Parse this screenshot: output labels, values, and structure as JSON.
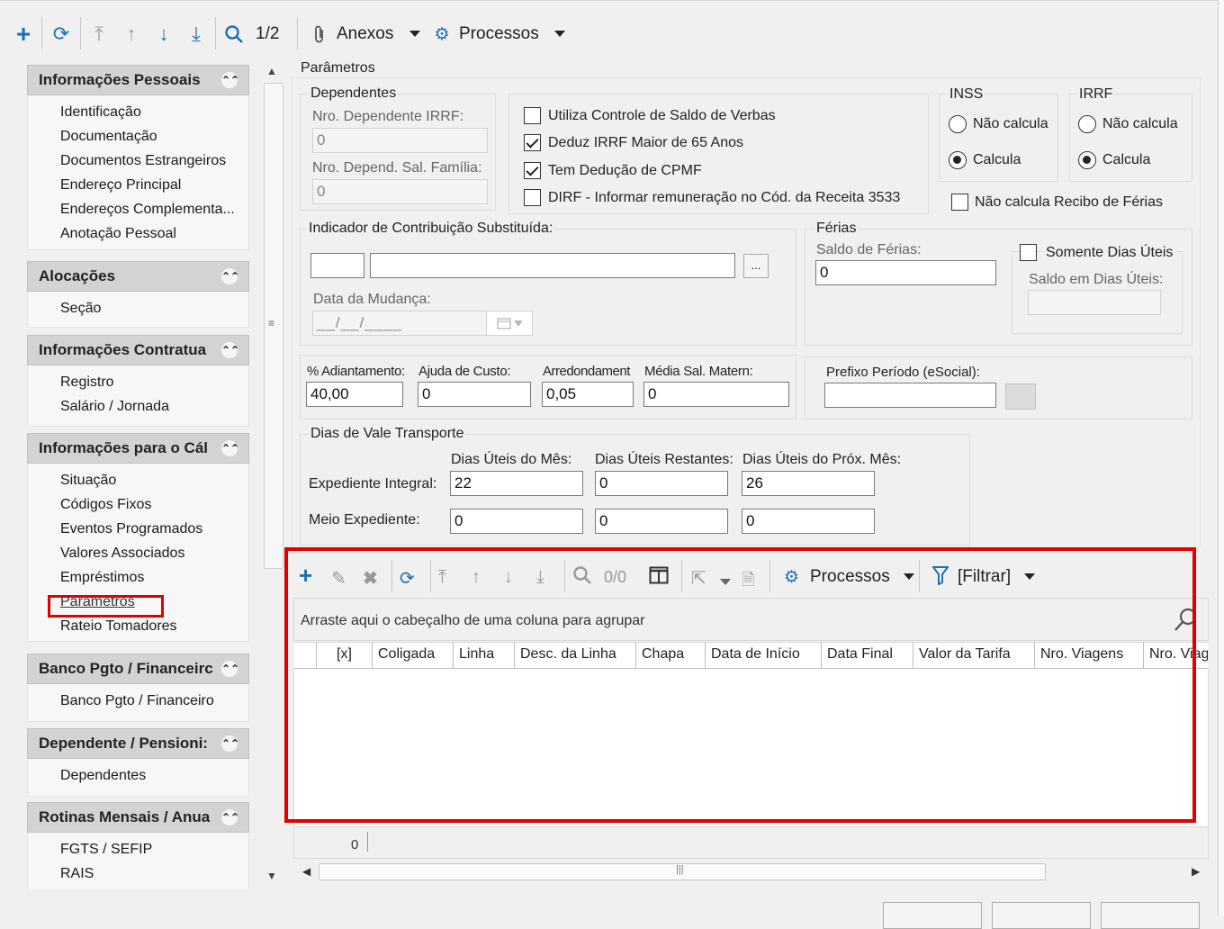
{
  "toolbar": {
    "page_indicator": "1/2",
    "anexos_label": "Anexos",
    "processos_label": "Processos"
  },
  "sidebar": {
    "groups": [
      {
        "title": "Informações Pessoais",
        "items": [
          "Identificação",
          "Documentação",
          "Documentos Estrangeiros",
          "Endereço Principal",
          "Endereços Complementa...",
          "Anotação Pessoal"
        ]
      },
      {
        "title": "Alocações",
        "items": [
          "Seção"
        ]
      },
      {
        "title": "Informações Contratua",
        "items": [
          "Registro",
          "Salário / Jornada"
        ]
      },
      {
        "title": "Informações para o Cál",
        "items": [
          "Situação",
          "Códigos Fixos",
          "Eventos Programados",
          "Valores Associados",
          "Empréstimos",
          "Parâmetros",
          "Rateio Tomadores"
        ]
      },
      {
        "title": "Banco Pgto / Financeirc",
        "items": [
          "Banco Pgto / Financeiro"
        ]
      },
      {
        "title": "Dependente / Pensioni:",
        "items": [
          "Dependentes"
        ]
      },
      {
        "title": "Rotinas Mensais / Anua",
        "items": [
          "FGTS / SEFIP",
          "RAIS"
        ]
      }
    ]
  },
  "params": {
    "title": "Parâmetros",
    "dependentes": {
      "title": "Dependentes",
      "irrf_label": "Nro. Dependente IRRF:",
      "irrf_value": "0",
      "salfam_label": "Nro. Depend. Sal. Família:",
      "salfam_value": "0"
    },
    "checks": {
      "saldo_verbas": "Utiliza Controle de Saldo de Verbas",
      "deduz_irrf": "Deduz IRRF Maior de 65 Anos",
      "cpmf": "Tem Dedução de CPMF",
      "dirf": "DIRF - Informar remuneração no Cód. da Receita 3533"
    },
    "inss": {
      "title": "INSS",
      "opt1": "Não calcula",
      "opt2": "Calcula"
    },
    "irrf": {
      "title": "IRRF",
      "opt1": "Não calcula",
      "opt2": "Calcula"
    },
    "recibo_ferias": "Não calcula Recibo de Férias",
    "indicador": {
      "title": "Indicador de Contribuição Substituída:",
      "browse": "...",
      "data_mudanca_label": "Data da Mudança:",
      "data_mudanca_value": "__/__/____"
    },
    "ferias": {
      "title": "Férias",
      "saldo_label": "Saldo de Férias:",
      "saldo_value": "0",
      "somente_uteis": "Somente Dias Úteis",
      "saldo_uteis_label": "Saldo em Dias Úteis:"
    },
    "valores": {
      "adiantamento_label": "% Adiantamento:",
      "adiantamento_value": "40,00",
      "ajuda_label": "Ajuda de Custo:",
      "ajuda_value": "0",
      "arredond_label": "Arredondament",
      "arredond_value": "0,05",
      "media_label": "Média Sal. Matern:",
      "media_value": "0",
      "prefixo_label": "Prefixo Período (eSocial):"
    },
    "vale": {
      "title": "Dias de Vale Transporte",
      "col1": "Dias Úteis do Mês:",
      "col2": "Dias Úteis Restantes:",
      "col3": "Dias Úteis do Próx. Mês:",
      "row1_label": "Expediente Integral:",
      "row1": [
        "22",
        "0",
        "26"
      ],
      "row2_label": "Meio Expediente:",
      "row2": [
        "0",
        "0",
        "0"
      ]
    }
  },
  "grid": {
    "counter": "0/0",
    "processos_label": "Processos",
    "filtrar_label": "[Filtrar]",
    "group_hint": "Arraste aqui o cabeçalho de uma coluna para agrupar",
    "columns": [
      "[x]",
      "Coligada",
      "Linha",
      "Desc. da Linha",
      "Chapa",
      "Data de Início",
      "Data Final",
      "Valor da Tarifa",
      "Nro. Viagens",
      "Nro. Viag"
    ],
    "footer_count": "0"
  },
  "highlight_color": "#e00000",
  "accent_color": "#1f6fb5"
}
